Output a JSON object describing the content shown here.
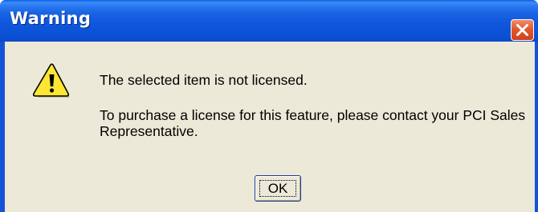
{
  "dialog": {
    "title": "Warning",
    "icon": "warning-triangle-icon",
    "message_primary": "The selected item is not licensed.",
    "message_secondary": "To purchase a license for this feature, please contact your PCI Sales Representative.",
    "ok_label": "OK",
    "close_icon": "close-x-icon"
  },
  "colors": {
    "titlebar": "#0c52d6",
    "close_button": "#e4582e",
    "client_background": "#ece9d8",
    "warning_yellow": "#ffe633",
    "focus_border": "#1c3f94"
  }
}
